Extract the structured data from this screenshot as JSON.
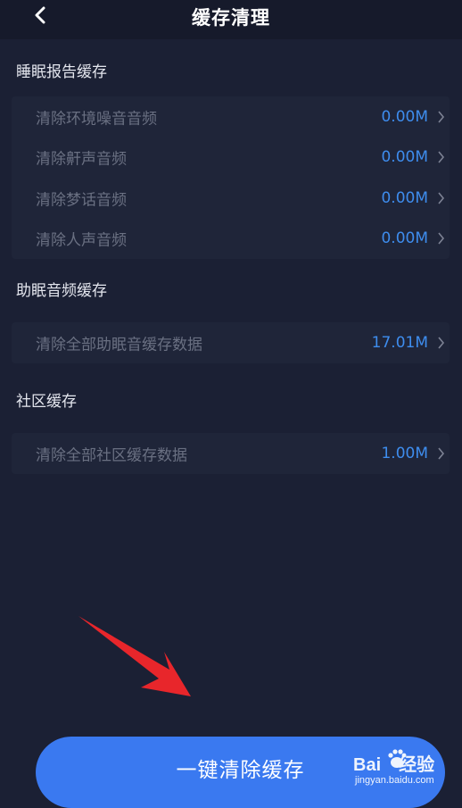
{
  "header": {
    "title": "缓存清理"
  },
  "sections": [
    {
      "title": "睡眠报告缓存",
      "rows": [
        {
          "label": "清除环境噪音音频",
          "value": "0.00M"
        },
        {
          "label": "清除鼾声音频",
          "value": "0.00M"
        },
        {
          "label": "清除梦话音频",
          "value": "0.00M"
        },
        {
          "label": "清除人声音频",
          "value": "0.00M"
        }
      ]
    },
    {
      "title": "助眠音频缓存",
      "rows": [
        {
          "label": "清除全部助眠音缓存数据",
          "value": "17.01M"
        }
      ]
    },
    {
      "title": "社区缓存",
      "rows": [
        {
          "label": "清除全部社区缓存数据",
          "value": "1.00M"
        }
      ]
    }
  ],
  "button": {
    "label": "一键清除缓存"
  },
  "watermark": {
    "brand_left": "Bai",
    "brand_right": "经验",
    "url": "jingyan.baidu.com"
  },
  "colors": {
    "background": "#1b2034",
    "card": "#1f2539",
    "accent": "#3e8dee",
    "button": "#3a79f0",
    "arrow": "#e8262b"
  }
}
